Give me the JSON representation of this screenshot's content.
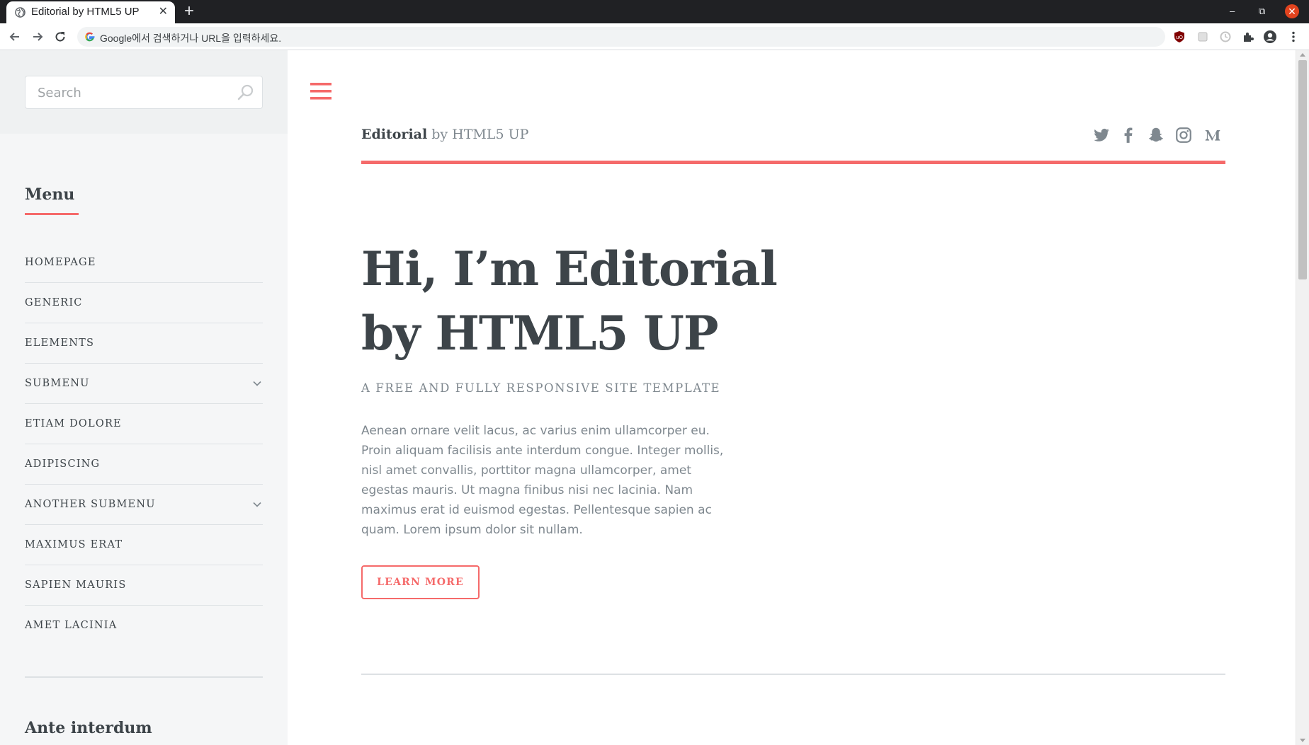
{
  "browser": {
    "tab_title": "Editorial by HTML5 UP",
    "new_tab_symbol": "+",
    "close_symbol": "✕",
    "omnibox_placeholder": "Google에서 검색하거나 URL을 입력하세요.",
    "window_controls": {
      "minimize": "–",
      "maximize": "⧉",
      "close": "✕"
    }
  },
  "sidebar": {
    "search_placeholder": "Search",
    "menu_heading": "Menu",
    "items": [
      {
        "label": "HOMEPAGE",
        "has_submenu": false
      },
      {
        "label": "GENERIC",
        "has_submenu": false
      },
      {
        "label": "ELEMENTS",
        "has_submenu": false
      },
      {
        "label": "SUBMENU",
        "has_submenu": true
      },
      {
        "label": "ETIAM DOLORE",
        "has_submenu": false
      },
      {
        "label": "ADIPISCING",
        "has_submenu": false
      },
      {
        "label": "ANOTHER SUBMENU",
        "has_submenu": true
      },
      {
        "label": "MAXIMUS ERAT",
        "has_submenu": false
      },
      {
        "label": "SAPIEN MAURIS",
        "has_submenu": false
      },
      {
        "label": "AMET LACINIA",
        "has_submenu": false
      }
    ],
    "second_heading": "Ante interdum"
  },
  "header": {
    "brand_strong": "Editorial",
    "brand_rest": " by HTML5 UP",
    "socials": [
      "twitter-icon",
      "facebook-icon",
      "snapchat-icon",
      "instagram-icon",
      "medium-icon"
    ]
  },
  "hero": {
    "title_line1": "Hi, I’m Editorial",
    "title_line2": "by HTML5 UP",
    "subtitle": "A FREE AND FULLY RESPONSIVE SITE TEMPLATE",
    "body": "Aenean ornare velit lacus, ac varius enim ullamcorper eu. Proin aliquam facilisis ante interdum congue. Integer mollis, nisl amet convallis, porttitor magna ullamcorper, amet egestas mauris. Ut magna finibus nisi nec lacinia. Nam maximus erat id euismod egestas. Pellentesque sapien ac quam. Lorem ipsum dolor sit nullam.",
    "button_label": "LEARN MORE"
  },
  "colors": {
    "accent": "#f56a6a",
    "text_dark": "#3d4449",
    "text_muted": "#7f888f",
    "sidebar_bg": "#f5f6f7"
  }
}
